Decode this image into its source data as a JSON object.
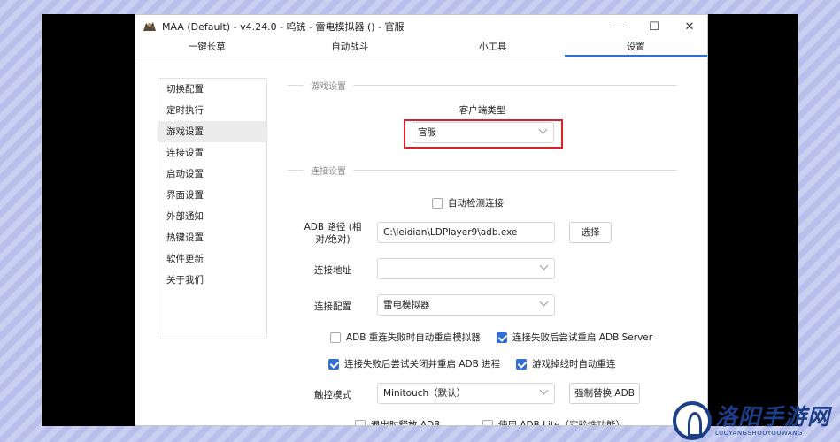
{
  "window": {
    "title": "MAA (Default) - v4.24.0 - 呜铳 - 雷电模拟器 () - 官服",
    "controls": {
      "minimize": "—",
      "maximize": "☐",
      "close": "✕"
    }
  },
  "tabs": [
    {
      "label": "一键长草",
      "active": false
    },
    {
      "label": "自动战斗",
      "active": false
    },
    {
      "label": "小工具",
      "active": false
    },
    {
      "label": "设置",
      "active": true
    }
  ],
  "sidebar": {
    "items": [
      {
        "label": "切换配置"
      },
      {
        "label": "定时执行"
      },
      {
        "label": "游戏设置"
      },
      {
        "label": "连接设置"
      },
      {
        "label": "启动设置"
      },
      {
        "label": "界面设置"
      },
      {
        "label": "外部通知"
      },
      {
        "label": "热键设置"
      },
      {
        "label": "软件更新"
      },
      {
        "label": "关于我们"
      }
    ],
    "active_index": 2
  },
  "game_settings": {
    "section_title": "游戏设置",
    "client_type_label": "客户端类型",
    "client_type_value": "官服"
  },
  "connection_settings": {
    "section_title": "连接设置",
    "auto_detect_label": "自动检测连接",
    "auto_detect_checked": false,
    "adb_path_label": "ADB 路径 (相对/绝对)",
    "adb_path_value": "C:\\leidian\\LDPlayer9\\adb.exe",
    "select_button": "选择",
    "address_label": "连接地址",
    "address_value": "",
    "config_label": "连接配置",
    "config_value": "雷电模拟器",
    "checks": [
      {
        "label": "ADB 重连失败时自动重启模拟器",
        "checked": false
      },
      {
        "label": "连接失败后尝试重启 ADB Server",
        "checked": true
      },
      {
        "label": "连接失败后尝试关闭并重启 ADB 进程",
        "checked": true
      },
      {
        "label": "游戏掉线时自动重连",
        "checked": true
      }
    ],
    "touch_mode_label": "触控模式",
    "touch_mode_value": "Minitouch（默认）",
    "replace_adb_button": "强制替换 ADB",
    "partial_checks": [
      {
        "label": "退出时释放 ADB",
        "checked": false
      },
      {
        "label": "使用 ADB Lite（实验性功能）",
        "checked": false
      }
    ]
  },
  "watermark": {
    "text_cn": "洛阳手游网",
    "text_en": "LUOYANGSHOUYOUWANG"
  },
  "colors": {
    "accent": "#2f6fd6",
    "highlight_box": "#d8232a",
    "watermark": "#1d3f8a"
  }
}
